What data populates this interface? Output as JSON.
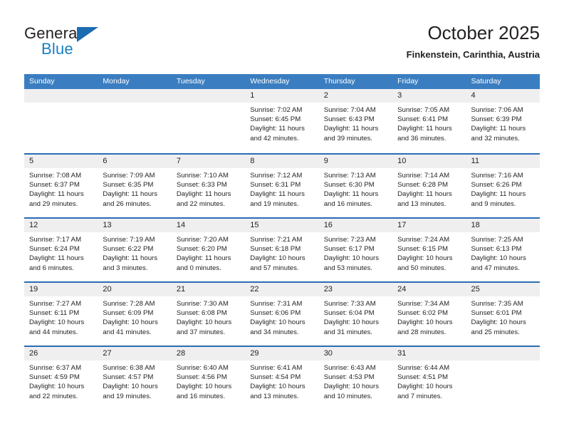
{
  "brand": {
    "name_part1": "General",
    "name_part2": "Blue"
  },
  "header": {
    "title": "October 2025",
    "subtitle": "Finkenstein, Carinthia, Austria"
  },
  "weekdays": [
    "Sunday",
    "Monday",
    "Tuesday",
    "Wednesday",
    "Thursday",
    "Friday",
    "Saturday"
  ],
  "labels": {
    "sunrise_prefix": "Sunrise: ",
    "sunset_prefix": "Sunset: ",
    "daylight_prefix": "Daylight: "
  },
  "colors": {
    "header_blue": "#3a7ec1",
    "row_divider_blue": "#2a6db5",
    "daynum_band": "#efeff0",
    "logo_blue": "#1b7fc4",
    "text": "#231f20"
  },
  "weeks": [
    [
      {
        "day": "",
        "empty": true
      },
      {
        "day": "",
        "empty": true
      },
      {
        "day": "",
        "empty": true
      },
      {
        "day": "1",
        "sunrise": "Sunrise: 7:02 AM",
        "sunset": "Sunset: 6:45 PM",
        "daylight": "Daylight: 11 hours and 42 minutes."
      },
      {
        "day": "2",
        "sunrise": "Sunrise: 7:04 AM",
        "sunset": "Sunset: 6:43 PM",
        "daylight": "Daylight: 11 hours and 39 minutes."
      },
      {
        "day": "3",
        "sunrise": "Sunrise: 7:05 AM",
        "sunset": "Sunset: 6:41 PM",
        "daylight": "Daylight: 11 hours and 36 minutes."
      },
      {
        "day": "4",
        "sunrise": "Sunrise: 7:06 AM",
        "sunset": "Sunset: 6:39 PM",
        "daylight": "Daylight: 11 hours and 32 minutes."
      }
    ],
    [
      {
        "day": "5",
        "sunrise": "Sunrise: 7:08 AM",
        "sunset": "Sunset: 6:37 PM",
        "daylight": "Daylight: 11 hours and 29 minutes."
      },
      {
        "day": "6",
        "sunrise": "Sunrise: 7:09 AM",
        "sunset": "Sunset: 6:35 PM",
        "daylight": "Daylight: 11 hours and 26 minutes."
      },
      {
        "day": "7",
        "sunrise": "Sunrise: 7:10 AM",
        "sunset": "Sunset: 6:33 PM",
        "daylight": "Daylight: 11 hours and 22 minutes."
      },
      {
        "day": "8",
        "sunrise": "Sunrise: 7:12 AM",
        "sunset": "Sunset: 6:31 PM",
        "daylight": "Daylight: 11 hours and 19 minutes."
      },
      {
        "day": "9",
        "sunrise": "Sunrise: 7:13 AM",
        "sunset": "Sunset: 6:30 PM",
        "daylight": "Daylight: 11 hours and 16 minutes."
      },
      {
        "day": "10",
        "sunrise": "Sunrise: 7:14 AM",
        "sunset": "Sunset: 6:28 PM",
        "daylight": "Daylight: 11 hours and 13 minutes."
      },
      {
        "day": "11",
        "sunrise": "Sunrise: 7:16 AM",
        "sunset": "Sunset: 6:26 PM",
        "daylight": "Daylight: 11 hours and 9 minutes."
      }
    ],
    [
      {
        "day": "12",
        "sunrise": "Sunrise: 7:17 AM",
        "sunset": "Sunset: 6:24 PM",
        "daylight": "Daylight: 11 hours and 6 minutes."
      },
      {
        "day": "13",
        "sunrise": "Sunrise: 7:19 AM",
        "sunset": "Sunset: 6:22 PM",
        "daylight": "Daylight: 11 hours and 3 minutes."
      },
      {
        "day": "14",
        "sunrise": "Sunrise: 7:20 AM",
        "sunset": "Sunset: 6:20 PM",
        "daylight": "Daylight: 11 hours and 0 minutes."
      },
      {
        "day": "15",
        "sunrise": "Sunrise: 7:21 AM",
        "sunset": "Sunset: 6:18 PM",
        "daylight": "Daylight: 10 hours and 57 minutes."
      },
      {
        "day": "16",
        "sunrise": "Sunrise: 7:23 AM",
        "sunset": "Sunset: 6:17 PM",
        "daylight": "Daylight: 10 hours and 53 minutes."
      },
      {
        "day": "17",
        "sunrise": "Sunrise: 7:24 AM",
        "sunset": "Sunset: 6:15 PM",
        "daylight": "Daylight: 10 hours and 50 minutes."
      },
      {
        "day": "18",
        "sunrise": "Sunrise: 7:25 AM",
        "sunset": "Sunset: 6:13 PM",
        "daylight": "Daylight: 10 hours and 47 minutes."
      }
    ],
    [
      {
        "day": "19",
        "sunrise": "Sunrise: 7:27 AM",
        "sunset": "Sunset: 6:11 PM",
        "daylight": "Daylight: 10 hours and 44 minutes."
      },
      {
        "day": "20",
        "sunrise": "Sunrise: 7:28 AM",
        "sunset": "Sunset: 6:09 PM",
        "daylight": "Daylight: 10 hours and 41 minutes."
      },
      {
        "day": "21",
        "sunrise": "Sunrise: 7:30 AM",
        "sunset": "Sunset: 6:08 PM",
        "daylight": "Daylight: 10 hours and 37 minutes."
      },
      {
        "day": "22",
        "sunrise": "Sunrise: 7:31 AM",
        "sunset": "Sunset: 6:06 PM",
        "daylight": "Daylight: 10 hours and 34 minutes."
      },
      {
        "day": "23",
        "sunrise": "Sunrise: 7:33 AM",
        "sunset": "Sunset: 6:04 PM",
        "daylight": "Daylight: 10 hours and 31 minutes."
      },
      {
        "day": "24",
        "sunrise": "Sunrise: 7:34 AM",
        "sunset": "Sunset: 6:02 PM",
        "daylight": "Daylight: 10 hours and 28 minutes."
      },
      {
        "day": "25",
        "sunrise": "Sunrise: 7:35 AM",
        "sunset": "Sunset: 6:01 PM",
        "daylight": "Daylight: 10 hours and 25 minutes."
      }
    ],
    [
      {
        "day": "26",
        "sunrise": "Sunrise: 6:37 AM",
        "sunset": "Sunset: 4:59 PM",
        "daylight": "Daylight: 10 hours and 22 minutes."
      },
      {
        "day": "27",
        "sunrise": "Sunrise: 6:38 AM",
        "sunset": "Sunset: 4:57 PM",
        "daylight": "Daylight: 10 hours and 19 minutes."
      },
      {
        "day": "28",
        "sunrise": "Sunrise: 6:40 AM",
        "sunset": "Sunset: 4:56 PM",
        "daylight": "Daylight: 10 hours and 16 minutes."
      },
      {
        "day": "29",
        "sunrise": "Sunrise: 6:41 AM",
        "sunset": "Sunset: 4:54 PM",
        "daylight": "Daylight: 10 hours and 13 minutes."
      },
      {
        "day": "30",
        "sunrise": "Sunrise: 6:43 AM",
        "sunset": "Sunset: 4:53 PM",
        "daylight": "Daylight: 10 hours and 10 minutes."
      },
      {
        "day": "31",
        "sunrise": "Sunrise: 6:44 AM",
        "sunset": "Sunset: 4:51 PM",
        "daylight": "Daylight: 10 hours and 7 minutes."
      },
      {
        "day": "",
        "empty": true
      }
    ]
  ]
}
